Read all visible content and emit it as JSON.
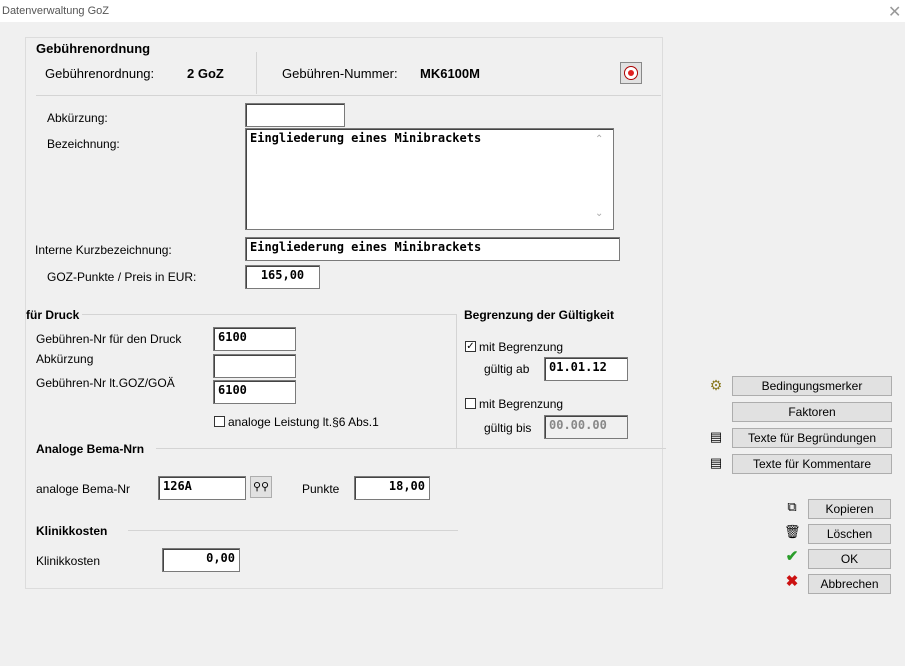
{
  "window": {
    "title": "Datenverwaltung GoZ"
  },
  "header": {
    "section": "Gebührenordnung",
    "go_label": "Gebührenordnung:",
    "go_value": "2 GoZ",
    "nr_label": "Gebühren-Nummer:",
    "nr_value": "MK6100M"
  },
  "main": {
    "abk_label": "Abkürzung:",
    "abk_value": "",
    "bez_label": "Bezeichnung:",
    "bez_value": "Eingliederung eines Minibrackets",
    "kurz_label": "Interne Kurzbezeichnung:",
    "kurz_value": "Eingliederung eines Minibrackets",
    "punkte_label": "GOZ-Punkte / Preis in EUR:",
    "punkte_value": "165,00"
  },
  "druck": {
    "section": "für Druck",
    "nr_label": "Gebühren-Nr für den Druck",
    "nr_value": "6100",
    "abk_label": "Abkürzung",
    "abk_value": "",
    "goz_label": "Gebühren-Nr lt.GOZ/GOÄ",
    "goz_value": "6100",
    "analog_label": "analoge Leistung lt.§6 Abs.1"
  },
  "gueltig": {
    "section": "Begrenzung der Gültigkeit",
    "mit1_label": "mit Begrenzung",
    "ab_label": "gültig ab",
    "ab_value": "01.01.12",
    "mit2_label": "mit Begrenzung",
    "bis_label": "gültig bis",
    "bis_value": "00.00.00"
  },
  "bema": {
    "section": "Analoge Bema-Nrn",
    "label": "analoge Bema-Nr",
    "value": "126A",
    "punkte_label": "Punkte",
    "punkte_value": "18,00"
  },
  "klinik": {
    "section": "Klinikkosten",
    "label": "Klinikkosten",
    "value": "0,00"
  },
  "side": {
    "bedingung": "Bedingungsmerker",
    "faktoren": "Faktoren",
    "begruendungen": "Texte für Begründungen",
    "kommentare": "Texte für Kommentare",
    "kopieren": "Kopieren",
    "loeschen": "Löschen",
    "ok": "OK",
    "abbrechen": "Abbrechen"
  },
  "colors": {
    "record_button": "#e02020",
    "ok_check": "#2a9d2a",
    "cancel_x": "#cc1111"
  }
}
